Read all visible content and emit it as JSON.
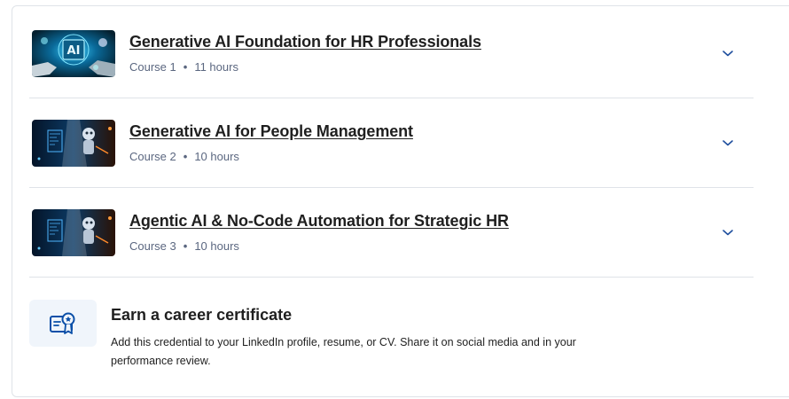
{
  "courses": [
    {
      "title": "Generative AI Foundation for HR Professionals",
      "number": "Course 1",
      "duration": "11 hours",
      "thumbnail": "ai-chip-handshake-image"
    },
    {
      "title": "Generative AI for People Management",
      "number": "Course 2",
      "duration": "10 hours",
      "thumbnail": "robot-circuit-image"
    },
    {
      "title": "Agentic AI & No-Code Automation for Strategic HR",
      "number": "Course 3",
      "duration": "10 hours",
      "thumbnail": "robot-circuit-image"
    }
  ],
  "separator": "•",
  "certificate": {
    "title": "Earn a career certificate",
    "description": "Add this credential to your LinkedIn profile, resume, or CV. Share it on social media and in your performance review.",
    "icon": "certificate-icon"
  },
  "colors": {
    "accent": "#0056d2",
    "meta_text": "#5b6780",
    "divider": "#dfe3e8",
    "icon_box": "#f0f5fb"
  }
}
